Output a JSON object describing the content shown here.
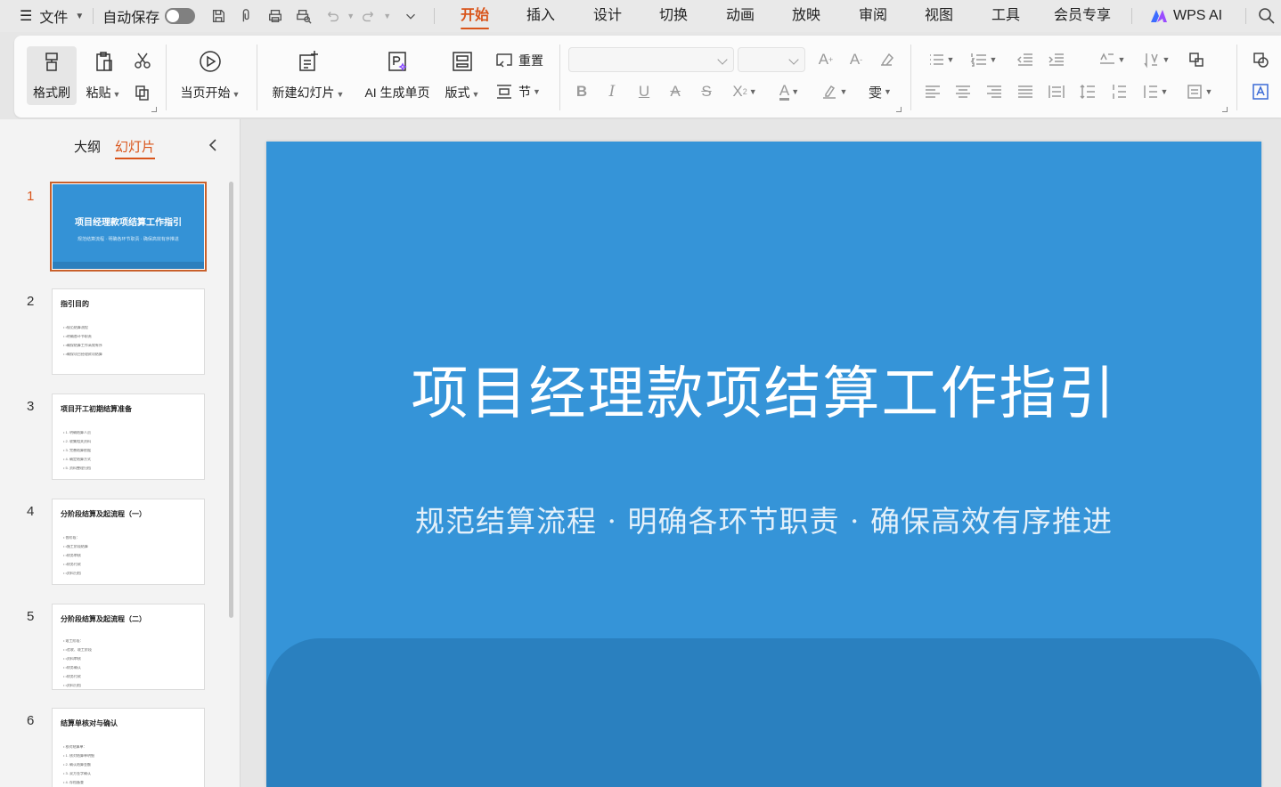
{
  "menubar": {
    "file_label": "文件",
    "autosave_label": "自动保存",
    "tabs": [
      "开始",
      "插入",
      "设计",
      "切换",
      "动画",
      "放映",
      "审阅",
      "视图",
      "工具",
      "会员专享"
    ],
    "active_tab": "开始",
    "wps_ai_label": "WPS AI"
  },
  "ribbon": {
    "format_painter": "格式刷",
    "paste": "粘贴",
    "from_current": "当页开始",
    "new_slide": "新建幻灯片",
    "ai_single_page": "AI 生成单页",
    "layout": "版式",
    "reset": "重置",
    "section": "节",
    "font_name": "",
    "font_size": ""
  },
  "panel": {
    "outline_tab": "大纲",
    "slides_tab": "幻灯片",
    "active_tab": "幻灯片",
    "selected_slide": 1,
    "thumbnails": [
      {
        "num": "1",
        "title": "项目经理款项结算工作指引",
        "subtitle": "规范结算流程 · 明确各环节职责 · 确保高效有序推进",
        "lines": []
      },
      {
        "num": "2",
        "title": "指引目的",
        "lines": [
          "• •规范结算流程",
          "• •明确各环节职责",
          "• •确保结算工作高效有序",
          "• •确保项目经理款项结算"
        ]
      },
      {
        "num": "3",
        "title": "项目开工初期结算准备",
        "lines": [
          "• 1. 明确结算人员",
          "• 2. 收集相关资料",
          "• 3. 完善结算依据",
          "• 4. 确定结算方式",
          "• 5. 资料整理归档"
        ]
      },
      {
        "num": "4",
        "title": "分阶段结算及起流程（一）",
        "lines": [
          "• 各阶段：",
          "• •施工阶段结算",
          "• •财务审核",
          "• •财务付款",
          "• •资料归档"
        ]
      },
      {
        "num": "5",
        "title": "分阶段结算及起流程（二）",
        "lines": [
          "• 竣工阶段：",
          "• •验收、竣工阶段",
          "• •资料审核",
          "• •财务确认",
          "• •财务付款",
          "• •资料归档"
        ]
      },
      {
        "num": "6",
        "title": "结算单核对与确认",
        "lines": [
          "• 核对结算单：",
          "• 1. 核对结算单明细",
          "• 2. 确认结算金额",
          "• 3. 双方签字确认",
          "• 4. 存档备查"
        ]
      }
    ]
  },
  "slide": {
    "title": "项目经理款项结算工作指引",
    "subtitle": "规范结算流程 · 明确各环节职责 · 确保高效有序推进",
    "background_color": "#3594d8",
    "band_color": "#2a80bf"
  },
  "colors": {
    "accent": "#d9541a",
    "ai_brand": "#7b4dff"
  }
}
